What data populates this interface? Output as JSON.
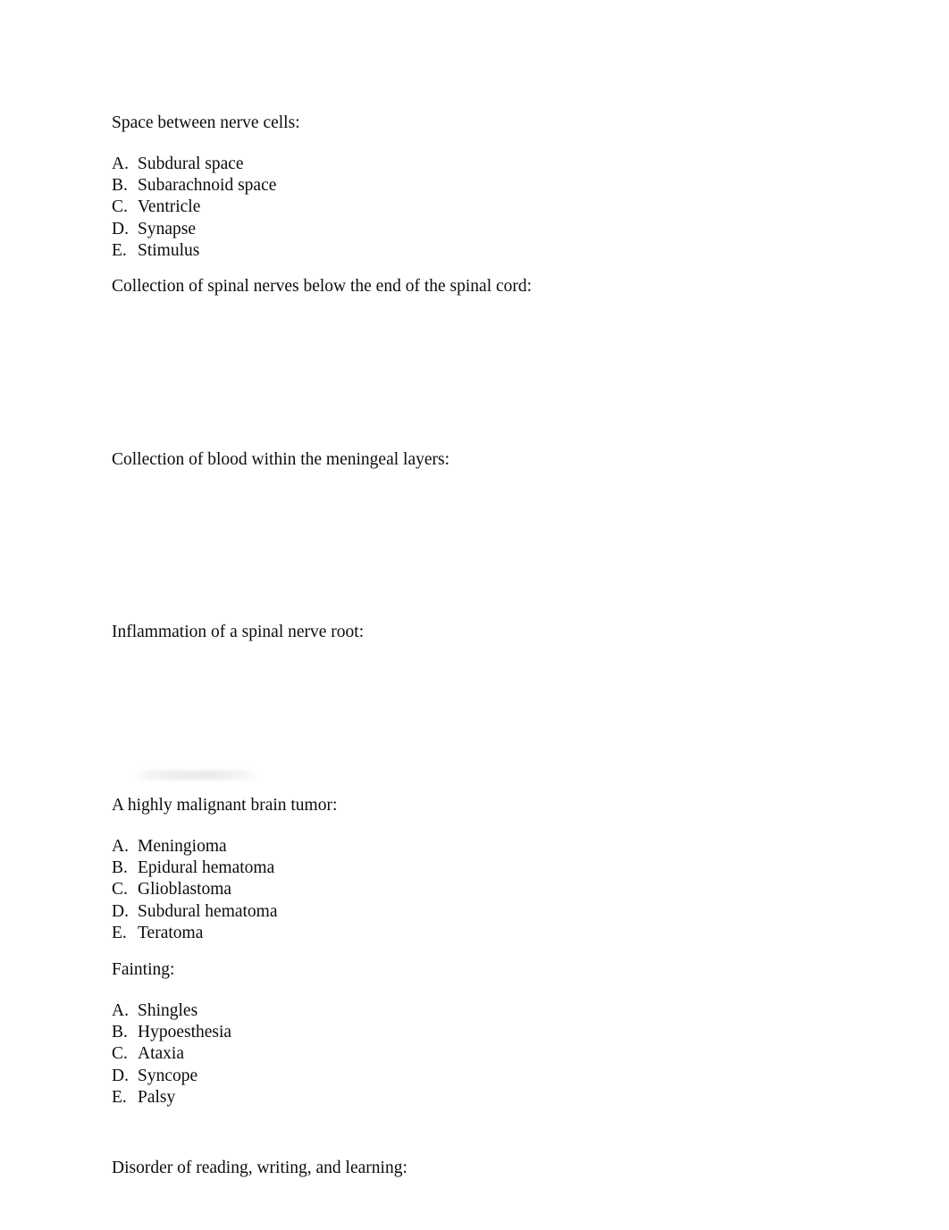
{
  "document": {
    "page_background": "#ffffff",
    "text_color": "#0d0d0d",
    "type": "multiple-choice-quiz-page"
  },
  "items": [
    {
      "id": "q1",
      "prompt": "Space between nerve cells:",
      "options": [
        {
          "marker": "A.",
          "text": "Subdural space"
        },
        {
          "marker": "B.",
          "text": "Subarachnoid space"
        },
        {
          "marker": "C.",
          "text": "Ventricle"
        },
        {
          "marker": "D.",
          "text": "Synapse"
        },
        {
          "marker": "E.",
          "text": "Stimulus"
        }
      ]
    },
    {
      "id": "q2",
      "prompt": "Collection of spinal nerves below the end of the spinal cord:",
      "options": []
    },
    {
      "id": "q3",
      "prompt": "Collection of blood within the meningeal layers:",
      "options": []
    },
    {
      "id": "q4",
      "prompt": "Inflammation of a spinal nerve root:",
      "options": []
    },
    {
      "id": "q5",
      "prompt": "A highly malignant brain tumor:",
      "options": [
        {
          "marker": "A.",
          "text": "Meningioma"
        },
        {
          "marker": "B.",
          "text": "Epidural hematoma"
        },
        {
          "marker": "C.",
          "text": "Glioblastoma"
        },
        {
          "marker": "D.",
          "text": "Subdural hematoma"
        },
        {
          "marker": "E.",
          "text": "Teratoma"
        }
      ]
    },
    {
      "id": "q6",
      "prompt": "Fainting:",
      "options": [
        {
          "marker": "A.",
          "text": "Shingles"
        },
        {
          "marker": "B.",
          "text": "Hypoesthesia"
        },
        {
          "marker": "C.",
          "text": "Ataxia"
        },
        {
          "marker": "D.",
          "text": "Syncope"
        },
        {
          "marker": "E.",
          "text": "Palsy"
        }
      ]
    },
    {
      "id": "q7",
      "prompt": "Disorder of reading, writing, and learning:",
      "options": []
    }
  ]
}
